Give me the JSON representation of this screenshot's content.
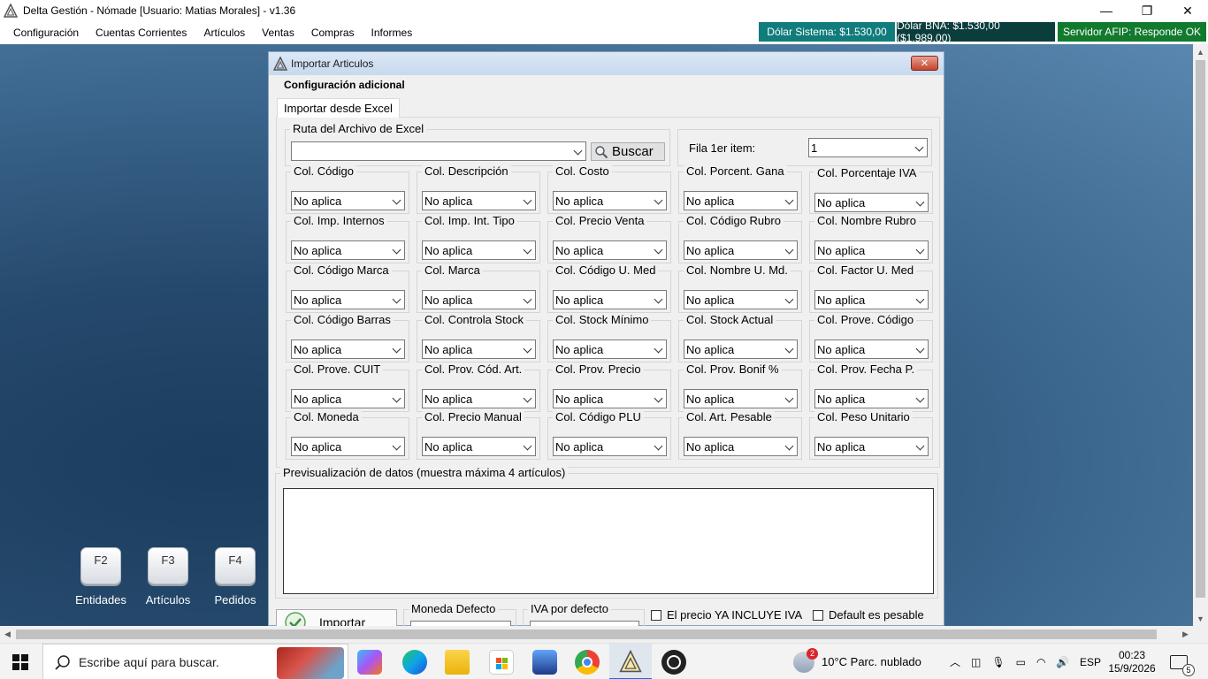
{
  "window": {
    "title": "Delta Gestión - Nómade [Usuario: Matias  Morales] - v1.36",
    "controls": {
      "minimize": "—",
      "restore": "❐",
      "close": "✕"
    }
  },
  "menu": [
    "Configuración",
    "Cuentas Corrientes",
    "Artículos",
    "Ventas",
    "Compras",
    "Informes"
  ],
  "status": {
    "dolar_sistema": "Dólar Sistema: $1.530,00",
    "dolar_bna": "Dólar BNA: $1.530,00 ($1.989,00)",
    "afip": "Servidor AFIP:  Responde OK"
  },
  "colors": {
    "teal": "#117c7c",
    "dark_teal": "#0b3d3d",
    "green": "#127a2e"
  },
  "fkeys": [
    {
      "key": "F2",
      "label": "Entidades"
    },
    {
      "key": "F3",
      "label": "Artículos"
    },
    {
      "key": "F4",
      "label": "Pedidos"
    }
  ],
  "dialog": {
    "title": "Importar Articulos",
    "subtitle": "Configuración adicional",
    "tab": "Importar desde Excel",
    "ruta_label": "Ruta del Archivo de Excel",
    "ruta_value": "",
    "buscar": "Buscar",
    "fila_label": "Fila 1er item:",
    "fila_value": "1",
    "columns": [
      {
        "label": "Col. Código",
        "value": "No aplica"
      },
      {
        "label": "Col. Descripción",
        "value": "No aplica"
      },
      {
        "label": "Col. Costo",
        "value": "No aplica"
      },
      {
        "label": "Col. Porcent. Gana",
        "value": "No aplica"
      },
      {
        "label": "Col. Porcentaje IVA",
        "value": "No aplica"
      },
      {
        "label": "Col. Imp. Internos",
        "value": "No aplica"
      },
      {
        "label": "Col. Imp. Int. Tipo",
        "value": "No aplica"
      },
      {
        "label": "Col. Precio Venta",
        "value": "No aplica"
      },
      {
        "label": "Col. Código Rubro",
        "value": "No aplica"
      },
      {
        "label": "Col. Nombre Rubro",
        "value": "No aplica"
      },
      {
        "label": "Col. Código Marca",
        "value": "No aplica"
      },
      {
        "label": "Col. Marca",
        "value": "No aplica"
      },
      {
        "label": "Col. Código U. Med",
        "value": "No aplica"
      },
      {
        "label": "Col. Nombre U. Md.",
        "value": "No aplica"
      },
      {
        "label": "Col. Factor U. Med",
        "value": "No aplica"
      },
      {
        "label": "Col. Código Barras",
        "value": "No aplica"
      },
      {
        "label": "Col. Controla Stock",
        "value": "No aplica"
      },
      {
        "label": "Col. Stock Mínimo",
        "value": "No aplica"
      },
      {
        "label": "Col. Stock Actual",
        "value": "No aplica"
      },
      {
        "label": "Col. Prove. Código",
        "value": "No aplica"
      },
      {
        "label": "Col. Prove. CUIT",
        "value": "No aplica"
      },
      {
        "label": "Col. Prov. Cód. Art.",
        "value": "No aplica"
      },
      {
        "label": "Col. Prov. Precio",
        "value": "No aplica"
      },
      {
        "label": "Col. Prov. Bonif %",
        "value": "No aplica"
      },
      {
        "label": "Col. Prov. Fecha P.",
        "value": "No aplica"
      },
      {
        "label": "Col. Moneda",
        "value": "No aplica"
      },
      {
        "label": "Col. Precio Manual",
        "value": "No aplica"
      },
      {
        "label": "Col. Código PLU",
        "value": "No aplica"
      },
      {
        "label": "Col. Art. Pesable",
        "value": "No aplica"
      },
      {
        "label": "Col. Peso Unitario",
        "value": "No aplica"
      }
    ],
    "preview_label": "Previsualización de datos (muestra máxima 4 artículos)",
    "import_btn": "Importar",
    "moneda_label": "Moneda Defecto",
    "iva_label": "IVA por defecto",
    "chk_iva": "El precio YA INCLUYE IVA",
    "chk_pesable": "Default es pesable"
  },
  "taskbar": {
    "search_placeholder": "Escribe aquí para buscar.",
    "weather": "10°C  Parc. nublado",
    "weather_badge": "2",
    "lang": "ESP",
    "time": "00:23",
    "date": "15/9/2026",
    "notif_count": "5"
  }
}
